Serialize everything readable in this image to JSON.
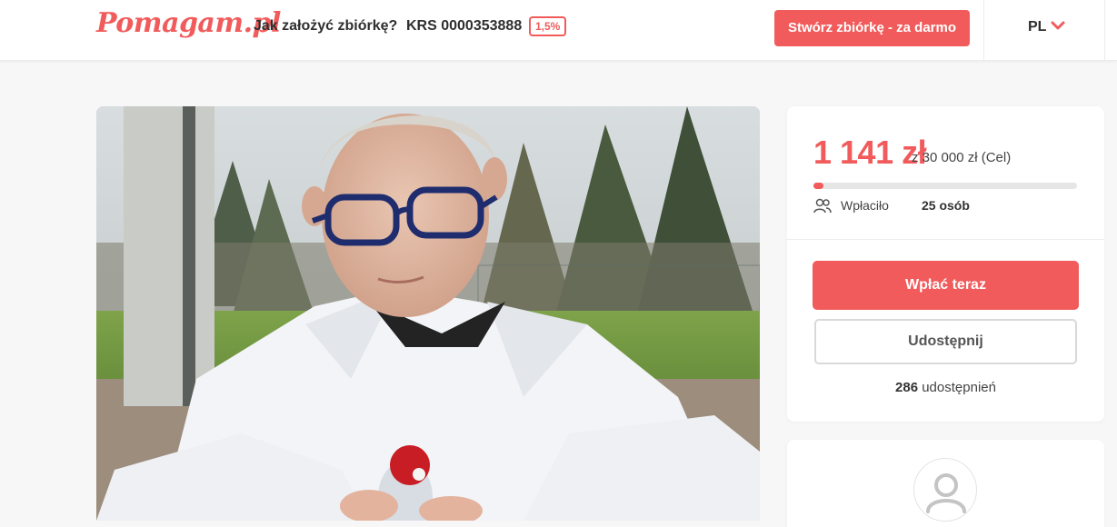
{
  "header": {
    "logo": "Pomagam.pl",
    "nav_how": "Jak założyć zbiórkę?",
    "krs": "KRS 0000353888",
    "percent_badge": "1,5%",
    "create_button": "Stwórz zbiórkę - za darmo",
    "language": "PL"
  },
  "campaign": {
    "raised": "1 141 zł",
    "goal": "z 30 000 zł (Cel)",
    "progress_fraction": 0.038,
    "donors_label": "Wpłaciło",
    "donors_count": "25 osób",
    "pay_button": "Wpłać teraz",
    "share_button": "Udostępnij",
    "shares_count": "286",
    "shares_label": "udostępnień"
  },
  "colors": {
    "accent": "#f15b5b"
  },
  "icons": {
    "lang_chevron": "chevron-down-icon",
    "donors": "people-icon",
    "organizer": "user-avatar-icon"
  }
}
